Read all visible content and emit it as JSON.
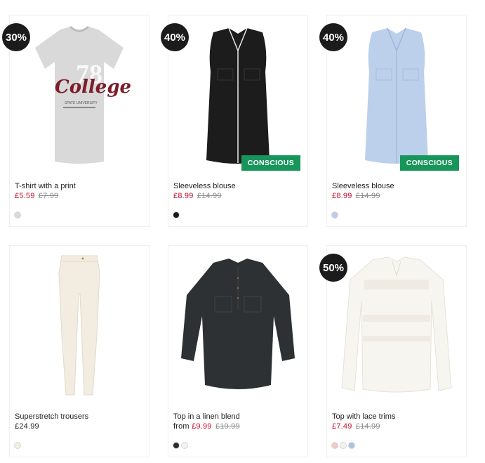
{
  "products": [
    {
      "name": "T-shirt with a print",
      "discount": "30%",
      "price_prefix": "",
      "price": "£5.59",
      "original_price": "£7.99",
      "tag": "",
      "image": "grey-college-tshirt",
      "swatches": [
        "#dcd8d4"
      ]
    },
    {
      "name": "Sleeveless blouse",
      "discount": "40%",
      "price_prefix": "",
      "price": "£8.99",
      "original_price": "£14.99",
      "tag": "CONSCIOUS",
      "image": "black-sleeveless-blouse",
      "swatches": [
        "#1a1a1a"
      ]
    },
    {
      "name": "Sleeveless blouse",
      "discount": "40%",
      "price_prefix": "",
      "price": "£8.99",
      "original_price": "£14.99",
      "tag": "CONSCIOUS",
      "image": "light-blue-sleeveless-blouse",
      "swatches": [
        "#b9cdea"
      ]
    },
    {
      "name": "Superstretch trousers",
      "discount": "",
      "price_prefix": "",
      "price": "£24.99",
      "original_price": "",
      "tag": "",
      "image": "cream-trousers",
      "swatches": [
        "#f3ede3"
      ]
    },
    {
      "name": "Top in a linen blend",
      "discount": "",
      "price_prefix": "from",
      "price": "£9.99",
      "original_price": "£19.99",
      "tag": "",
      "image": "dark-linen-top",
      "swatches": [
        "#2a2d2e",
        "#f4f1ea"
      ]
    },
    {
      "name": "Top with lace trims",
      "discount": "50%",
      "price_prefix": "",
      "price": "£7.49",
      "original_price": "£14.99",
      "tag": "",
      "image": "white-lace-top",
      "swatches": [
        "#f1c9cc",
        "#f4f2ec",
        "#a9c3e0"
      ]
    }
  ],
  "colors": {
    "sale_price": "#c8102e",
    "badge_bg": "#1b1b1b",
    "conscious_bg": "#18955a"
  }
}
